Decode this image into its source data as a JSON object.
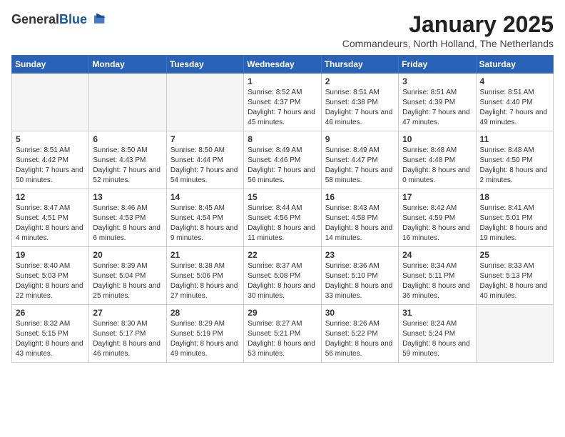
{
  "logo": {
    "line1": "General",
    "line2": "Blue"
  },
  "title": "January 2025",
  "subtitle": "Commandeurs, North Holland, The Netherlands",
  "weekdays": [
    "Sunday",
    "Monday",
    "Tuesday",
    "Wednesday",
    "Thursday",
    "Friday",
    "Saturday"
  ],
  "weeks": [
    [
      {
        "day": "",
        "empty": true
      },
      {
        "day": "",
        "empty": true
      },
      {
        "day": "",
        "empty": true
      },
      {
        "day": "1",
        "sunrise": "8:52 AM",
        "sunset": "4:37 PM",
        "daylight": "7 hours and 45 minutes."
      },
      {
        "day": "2",
        "sunrise": "8:51 AM",
        "sunset": "4:38 PM",
        "daylight": "7 hours and 46 minutes."
      },
      {
        "day": "3",
        "sunrise": "8:51 AM",
        "sunset": "4:39 PM",
        "daylight": "7 hours and 47 minutes."
      },
      {
        "day": "4",
        "sunrise": "8:51 AM",
        "sunset": "4:40 PM",
        "daylight": "7 hours and 49 minutes."
      }
    ],
    [
      {
        "day": "5",
        "sunrise": "8:51 AM",
        "sunset": "4:42 PM",
        "daylight": "7 hours and 50 minutes."
      },
      {
        "day": "6",
        "sunrise": "8:50 AM",
        "sunset": "4:43 PM",
        "daylight": "7 hours and 52 minutes."
      },
      {
        "day": "7",
        "sunrise": "8:50 AM",
        "sunset": "4:44 PM",
        "daylight": "7 hours and 54 minutes."
      },
      {
        "day": "8",
        "sunrise": "8:49 AM",
        "sunset": "4:46 PM",
        "daylight": "7 hours and 56 minutes."
      },
      {
        "day": "9",
        "sunrise": "8:49 AM",
        "sunset": "4:47 PM",
        "daylight": "7 hours and 58 minutes."
      },
      {
        "day": "10",
        "sunrise": "8:48 AM",
        "sunset": "4:48 PM",
        "daylight": "8 hours and 0 minutes."
      },
      {
        "day": "11",
        "sunrise": "8:48 AM",
        "sunset": "4:50 PM",
        "daylight": "8 hours and 2 minutes."
      }
    ],
    [
      {
        "day": "12",
        "sunrise": "8:47 AM",
        "sunset": "4:51 PM",
        "daylight": "8 hours and 4 minutes."
      },
      {
        "day": "13",
        "sunrise": "8:46 AM",
        "sunset": "4:53 PM",
        "daylight": "8 hours and 6 minutes."
      },
      {
        "day": "14",
        "sunrise": "8:45 AM",
        "sunset": "4:54 PM",
        "daylight": "8 hours and 9 minutes."
      },
      {
        "day": "15",
        "sunrise": "8:44 AM",
        "sunset": "4:56 PM",
        "daylight": "8 hours and 11 minutes."
      },
      {
        "day": "16",
        "sunrise": "8:43 AM",
        "sunset": "4:58 PM",
        "daylight": "8 hours and 14 minutes."
      },
      {
        "day": "17",
        "sunrise": "8:42 AM",
        "sunset": "4:59 PM",
        "daylight": "8 hours and 16 minutes."
      },
      {
        "day": "18",
        "sunrise": "8:41 AM",
        "sunset": "5:01 PM",
        "daylight": "8 hours and 19 minutes."
      }
    ],
    [
      {
        "day": "19",
        "sunrise": "8:40 AM",
        "sunset": "5:03 PM",
        "daylight": "8 hours and 22 minutes."
      },
      {
        "day": "20",
        "sunrise": "8:39 AM",
        "sunset": "5:04 PM",
        "daylight": "8 hours and 25 minutes."
      },
      {
        "day": "21",
        "sunrise": "8:38 AM",
        "sunset": "5:06 PM",
        "daylight": "8 hours and 27 minutes."
      },
      {
        "day": "22",
        "sunrise": "8:37 AM",
        "sunset": "5:08 PM",
        "daylight": "8 hours and 30 minutes."
      },
      {
        "day": "23",
        "sunrise": "8:36 AM",
        "sunset": "5:10 PM",
        "daylight": "8 hours and 33 minutes."
      },
      {
        "day": "24",
        "sunrise": "8:34 AM",
        "sunset": "5:11 PM",
        "daylight": "8 hours and 36 minutes."
      },
      {
        "day": "25",
        "sunrise": "8:33 AM",
        "sunset": "5:13 PM",
        "daylight": "8 hours and 40 minutes."
      }
    ],
    [
      {
        "day": "26",
        "sunrise": "8:32 AM",
        "sunset": "5:15 PM",
        "daylight": "8 hours and 43 minutes."
      },
      {
        "day": "27",
        "sunrise": "8:30 AM",
        "sunset": "5:17 PM",
        "daylight": "8 hours and 46 minutes."
      },
      {
        "day": "28",
        "sunrise": "8:29 AM",
        "sunset": "5:19 PM",
        "daylight": "8 hours and 49 minutes."
      },
      {
        "day": "29",
        "sunrise": "8:27 AM",
        "sunset": "5:21 PM",
        "daylight": "8 hours and 53 minutes."
      },
      {
        "day": "30",
        "sunrise": "8:26 AM",
        "sunset": "5:22 PM",
        "daylight": "8 hours and 56 minutes."
      },
      {
        "day": "31",
        "sunrise": "8:24 AM",
        "sunset": "5:24 PM",
        "daylight": "8 hours and 59 minutes."
      },
      {
        "day": "",
        "empty": true
      }
    ]
  ]
}
